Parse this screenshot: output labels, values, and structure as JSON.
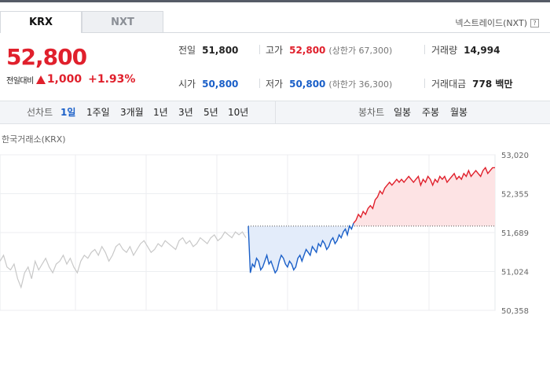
{
  "tabs": [
    {
      "label": "KRX",
      "active": true
    },
    {
      "label": "NXT",
      "active": false
    }
  ],
  "nxt_link": "넥스트레이드(NXT)",
  "help_mark": "?",
  "price": {
    "current": "52,800",
    "change_label": "전일대비",
    "change": "1,000",
    "change_pct": "+1.93%"
  },
  "stats": {
    "prev_close": {
      "label": "전일",
      "value": "51,800"
    },
    "open": {
      "label": "시가",
      "value": "50,800"
    },
    "high": {
      "label": "고가",
      "value": "52,800",
      "sub": "(상한가 67,300)"
    },
    "low": {
      "label": "저가",
      "value": "50,800",
      "sub": "(하한가 36,300)"
    },
    "volume": {
      "label": "거래량",
      "value": "14,994"
    },
    "amount": {
      "label": "거래대금",
      "value": "778 백만"
    }
  },
  "toolbar": {
    "line_label": "선차트",
    "line_periods": [
      "1일",
      "1주일",
      "3개월",
      "1년",
      "3년",
      "5년",
      "10년"
    ],
    "selected_period": "1일",
    "candle_label": "봉차트",
    "candle_periods": [
      "일봉",
      "주봉",
      "월봉"
    ]
  },
  "chart_caption": "한국거래소(KRX)",
  "chart_data": {
    "type": "line",
    "y_ticks": [
      "53,020",
      "52,355",
      "51,689",
      "51,024",
      "50,358"
    ],
    "ylim": [
      50358,
      53020
    ],
    "baseline": 51800,
    "grid": true,
    "colors": {
      "up": "#e0202c",
      "down": "#1a5fc8",
      "prev_day": "#c8c8c8",
      "up_fill": "#fde3e4",
      "down_fill": "#e3ecfa"
    },
    "series": [
      {
        "values": [
          51200,
          51300,
          51100,
          51050,
          51150,
          50900,
          50750,
          51000,
          51100,
          50900,
          51200,
          51050,
          51150,
          51250,
          51100,
          51000,
          51150,
          51200,
          51300,
          51150,
          51250,
          51100,
          51000,
          51200,
          51300,
          51250,
          51350,
          51400,
          51300,
          51450,
          51350,
          51200,
          51300,
          51450,
          51500,
          51400,
          51350,
          51450,
          51300,
          51400,
          51500,
          51550,
          51450,
          51350,
          51400,
          51500,
          51450,
          51550,
          51500,
          51450,
          51400,
          51550,
          51600,
          51500,
          51550,
          51450,
          51500,
          51600,
          51550,
          51500,
          51600,
          51650,
          51550,
          51600,
          51700,
          51650,
          51600,
          51700,
          51650,
          51700,
          51600
        ]
      },
      {
        "values": [
          51800,
          51000,
          51150,
          51100,
          51250,
          51200,
          51050,
          51100,
          51200,
          51300,
          51150,
          51200,
          51100,
          51000,
          51050,
          51200,
          51300,
          51250,
          51150,
          51100,
          51200,
          51150,
          51050,
          51100,
          51250,
          51300,
          51200,
          51300,
          51400,
          51350,
          51300,
          51450,
          51400,
          51350,
          51500,
          51450,
          51550,
          51500,
          51400,
          51450,
          51550,
          51600,
          51500,
          51550,
          51650,
          51600,
          51700,
          51750,
          51650,
          51800,
          51750,
          51850
        ]
      },
      {
        "values": [
          51850,
          51900,
          52000,
          51950,
          52050,
          52000,
          52100,
          52150,
          52100,
          52250,
          52300,
          52400,
          52350,
          52450,
          52500,
          52550,
          52500,
          52550,
          52600,
          52550,
          52600,
          52550,
          52600,
          52650,
          52600,
          52550,
          52600,
          52650,
          52500,
          52600,
          52550,
          52650,
          52600,
          52500,
          52600,
          52550,
          52650,
          52600,
          52650,
          52550,
          52600,
          52650,
          52700,
          52600,
          52650,
          52600,
          52700,
          52650,
          52750,
          52650,
          52700,
          52750,
          52700,
          52650,
          52750,
          52800,
          52700,
          52750,
          52800,
          52800
        ]
      }
    ]
  }
}
